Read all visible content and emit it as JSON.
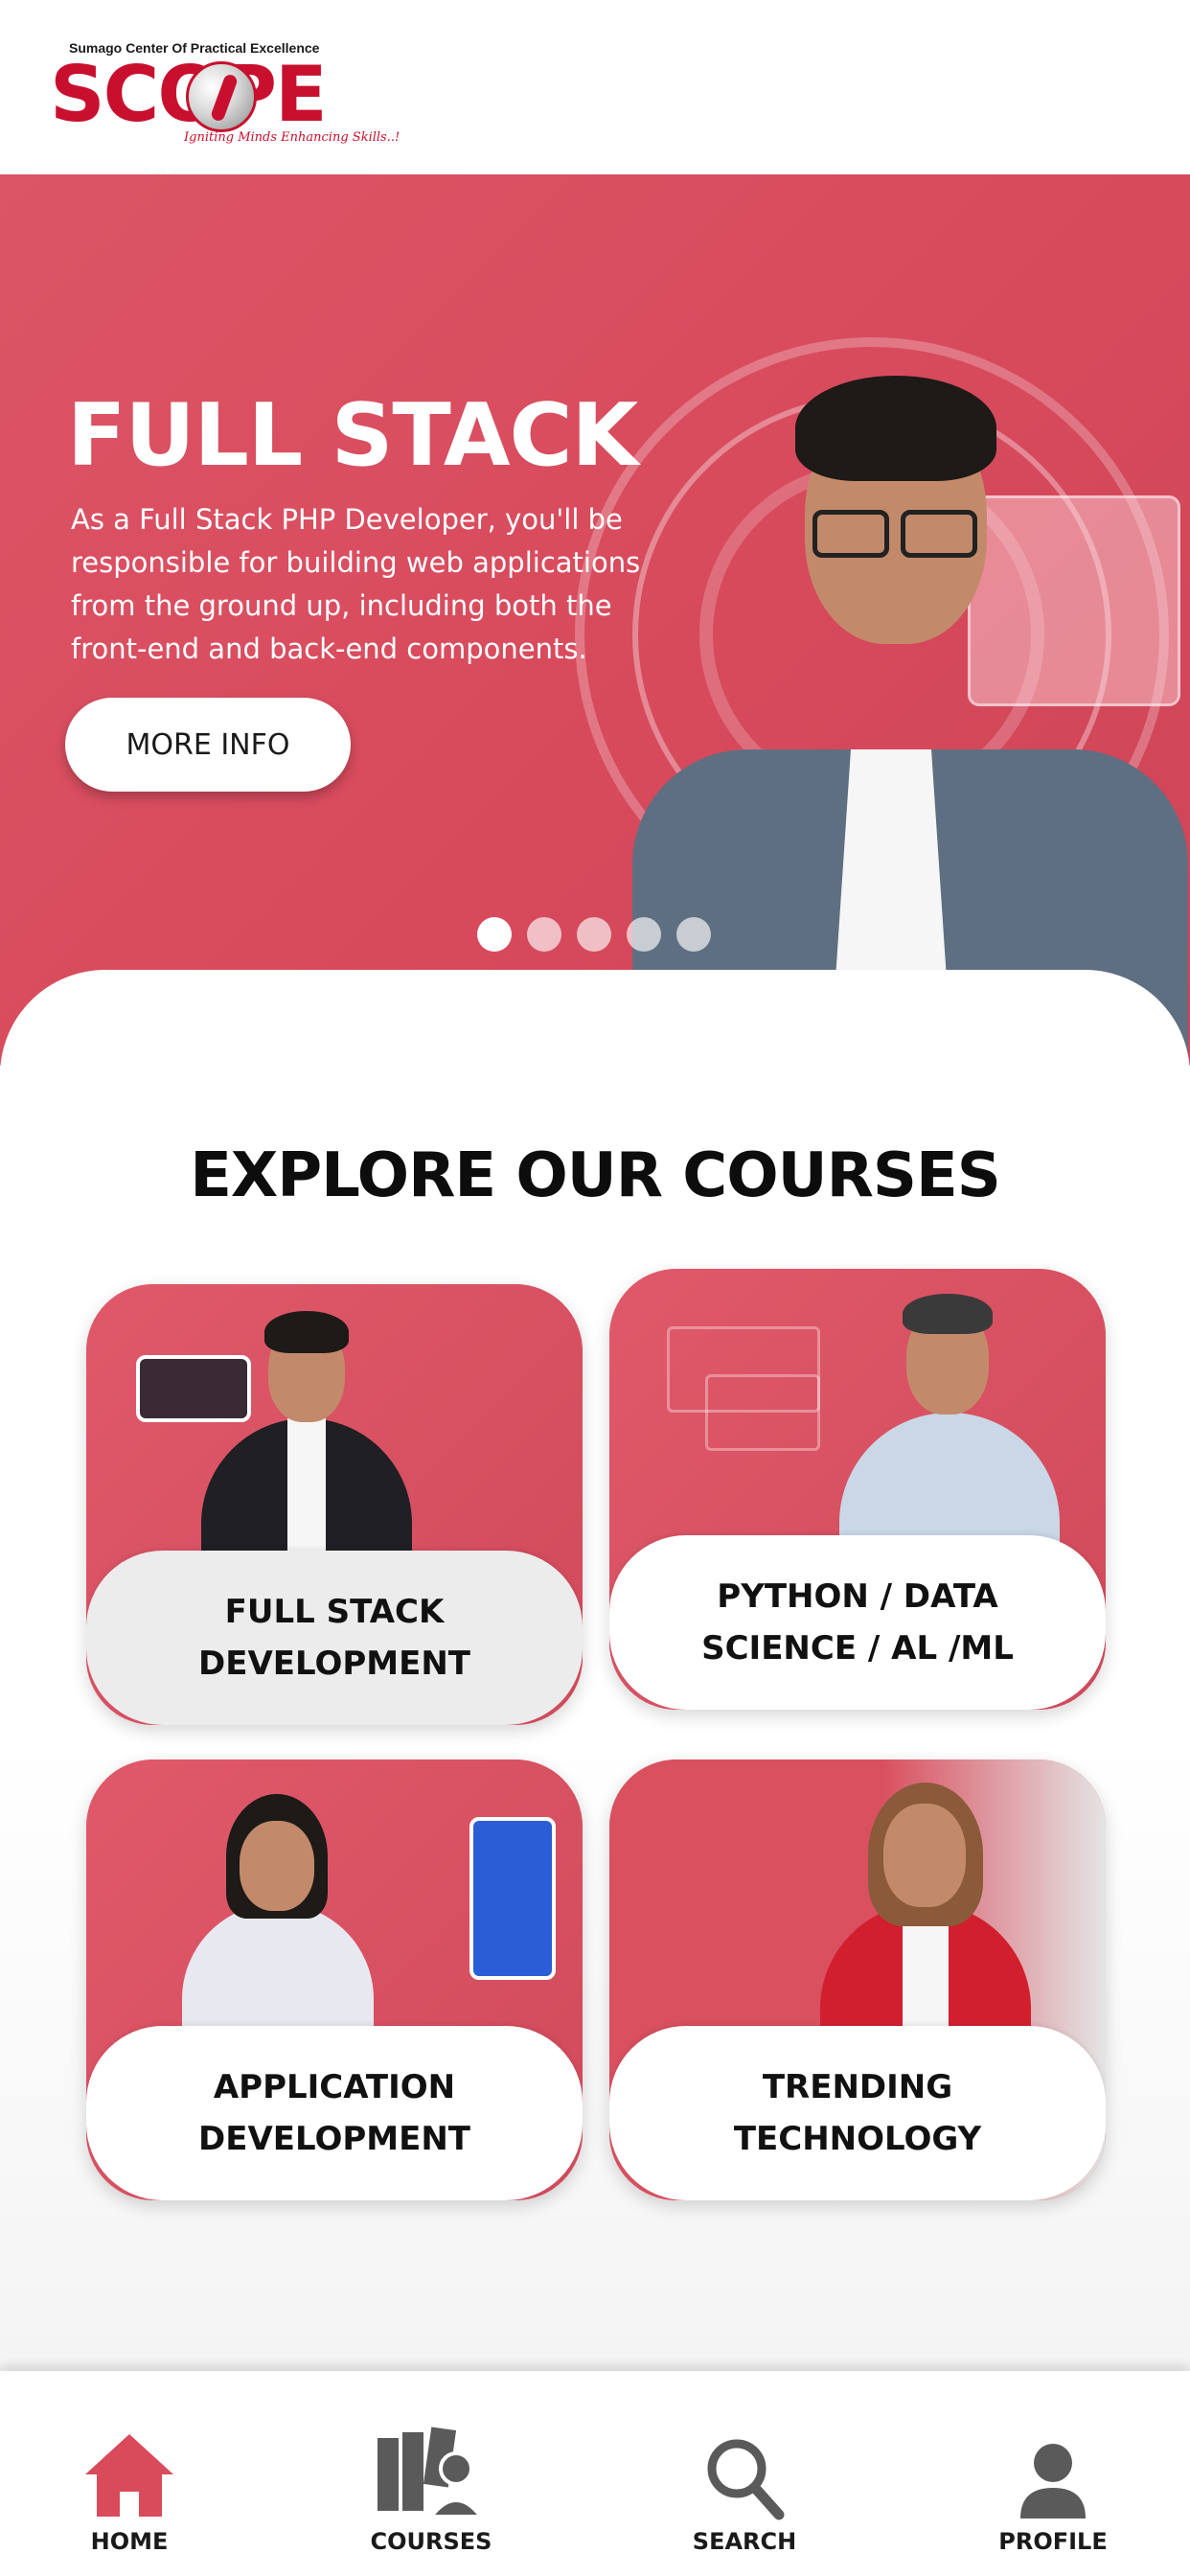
{
  "header": {
    "logo": {
      "top_text": "Sumago Center Of Practical Excellence",
      "word": "SCOPE",
      "tagline": "Igniting Minds Enhancing Skills..!"
    }
  },
  "hero": {
    "title": "FULL STACK",
    "description": "As a Full Stack PHP Developer, you'll be responsible for building web applications from the ground up, including both the front-end and back-end components.",
    "button_label": "MORE INFO",
    "slide_count": 5,
    "active_slide": 1
  },
  "courses": {
    "title": "EXPLORE OUR COURSES",
    "items": [
      {
        "label": "FULL STACK DEVELOPMENT"
      },
      {
        "label": "PYTHON / DATA SCIENCE / AL /ML"
      },
      {
        "label": "APPLICATION DEVELOPMENT"
      },
      {
        "label": "TRENDING TECHNOLOGY"
      }
    ]
  },
  "nav": {
    "items": [
      {
        "label": "HOME",
        "icon": "home-icon",
        "active": true
      },
      {
        "label": "COURSES",
        "icon": "courses-icon",
        "active": false
      },
      {
        "label": "SEARCH",
        "icon": "search-icon",
        "active": false
      },
      {
        "label": "PROFILE",
        "icon": "profile-icon",
        "active": false
      }
    ]
  },
  "colors": {
    "brand": "#c8102e",
    "hero_bg": "#d84b5d",
    "nav_active": "#d94a5b",
    "nav_inactive": "#5a5a5a"
  }
}
